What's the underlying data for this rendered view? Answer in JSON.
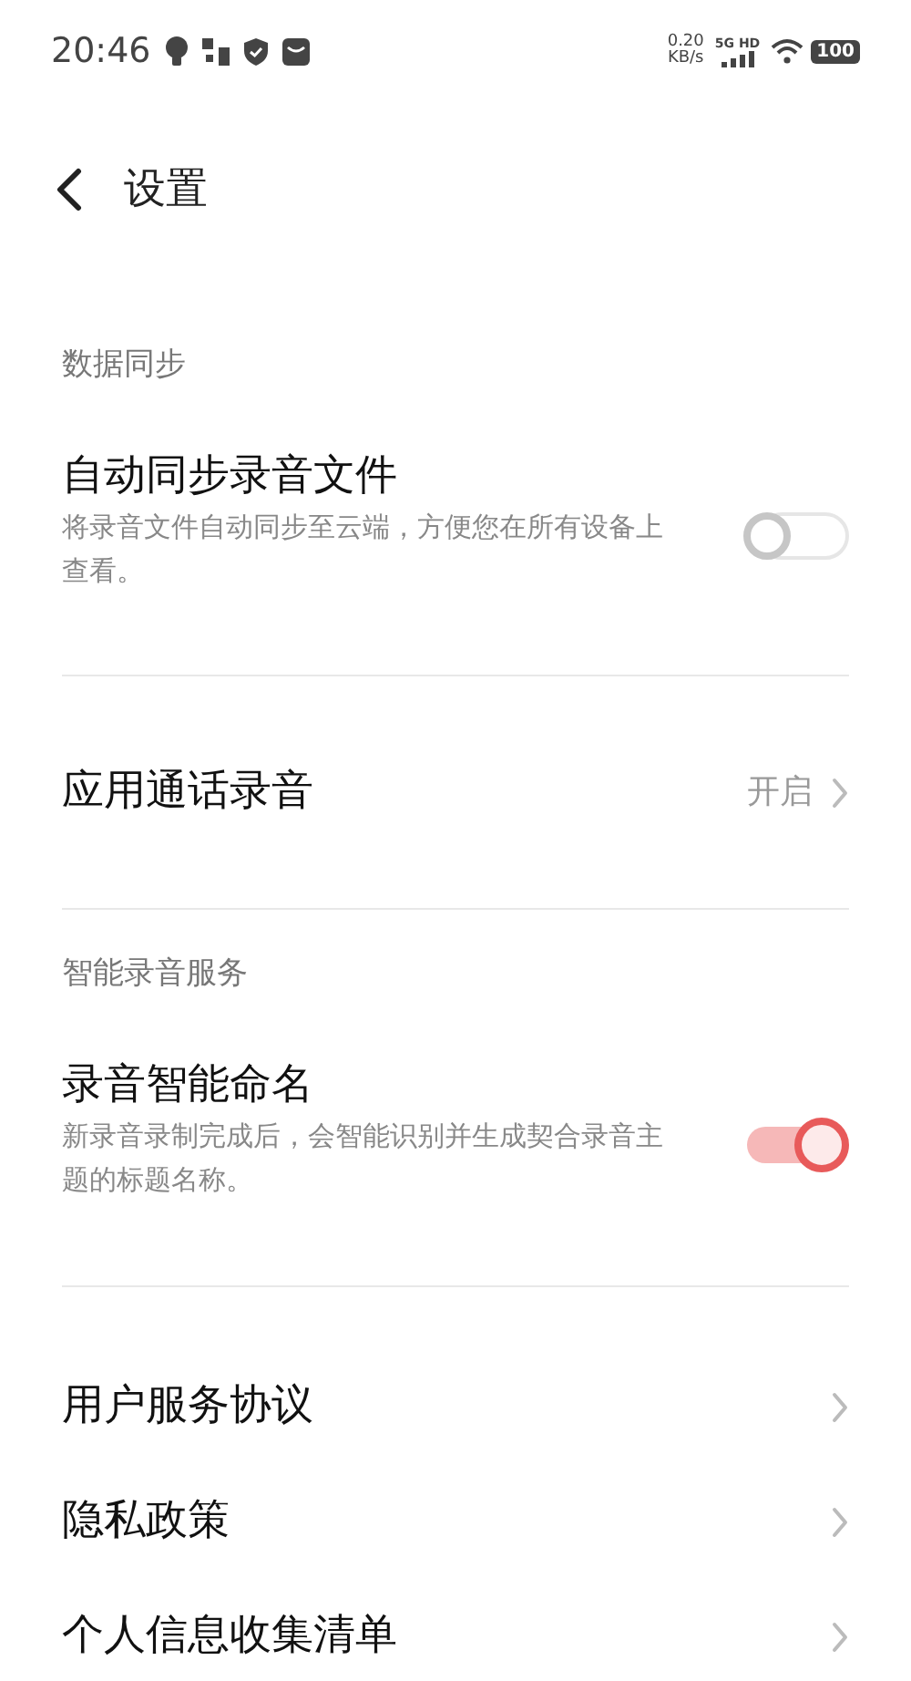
{
  "status_bar": {
    "time": "20:46",
    "speed_value": "0.20",
    "speed_unit": "KB/s",
    "network": "5G HD",
    "battery": "100"
  },
  "header": {
    "title": "设置"
  },
  "groups": [
    {
      "label": "数据同步",
      "items": [
        {
          "kind": "toggle",
          "title": "自动同步录音文件",
          "description": "将录音文件自动同步至云端，方便您在所有设备上查看。",
          "on": false
        }
      ]
    },
    {
      "items": [
        {
          "kind": "link",
          "title": "应用通话录音",
          "value": "开启"
        }
      ]
    },
    {
      "label": "智能录音服务",
      "items": [
        {
          "kind": "toggle",
          "title": "录音智能命名",
          "description": "新录音录制完成后，会智能识别并生成契合录音主题的标题名称。",
          "on": true
        }
      ]
    },
    {
      "items": [
        {
          "kind": "link",
          "title": "用户服务协议"
        },
        {
          "kind": "link",
          "title": "隐私政策"
        },
        {
          "kind": "link",
          "title": "个人信息收集清单"
        }
      ]
    }
  ]
}
